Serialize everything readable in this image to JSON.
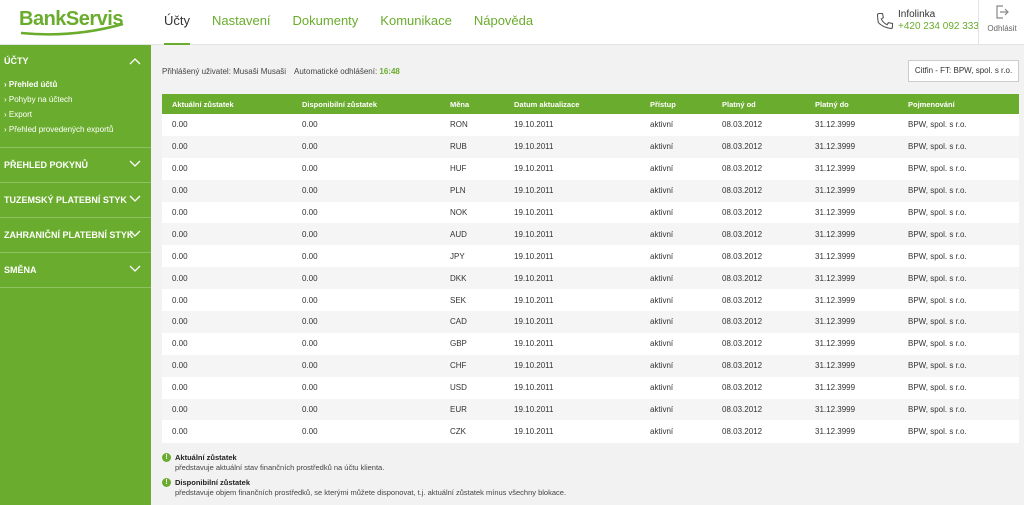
{
  "header": {
    "logo": "BankServis",
    "nav": [
      "Účty",
      "Nastavení",
      "Dokumenty",
      "Komunikace",
      "Nápověda"
    ],
    "info_title": "Infolinka",
    "info_phone": "+420 234 092 333",
    "logout_label": "Odhlásit",
    "brand_color": "#6aac2d"
  },
  "sidebar": {
    "sections": [
      {
        "label": "Účty",
        "items": [
          "Přehled účtů",
          "Pohyby na účtech",
          "Export",
          "Přehled provedených exportů"
        ]
      },
      {
        "label": "Přehled pokynů"
      },
      {
        "label": "Tuzemský platební styk"
      },
      {
        "label": "Zahraniční platební styk"
      },
      {
        "label": "Směna"
      }
    ]
  },
  "topbar": {
    "user": "Přihlášený uživatel: Musaši Musaši",
    "auto_logout_label": "Automatické odhlášení:",
    "auto_logout_time": "16:48",
    "account_select": "Citfin - FT: BPW, spol. s r.o."
  },
  "table": {
    "columns": [
      "Aktuální zůstatek",
      "Disponibilní zůstatek",
      "Měna",
      "Datum aktualizace",
      "Přístup",
      "Platný od",
      "Platný do",
      "Pojmenování"
    ],
    "rows": [
      [
        "0.00",
        "0.00",
        "RON",
        "19.10.2011",
        "aktivní",
        "08.03.2012",
        "31.12.3999",
        "BPW, spol. s r.o."
      ],
      [
        "0.00",
        "0.00",
        "RUB",
        "19.10.2011",
        "aktivní",
        "08.03.2012",
        "31.12.3999",
        "BPW, spol. s r.o."
      ],
      [
        "0.00",
        "0.00",
        "HUF",
        "19.10.2011",
        "aktivní",
        "08.03.2012",
        "31.12.3999",
        "BPW, spol. s r.o."
      ],
      [
        "0.00",
        "0.00",
        "PLN",
        "19.10.2011",
        "aktivní",
        "08.03.2012",
        "31.12.3999",
        "BPW, spol. s r.o."
      ],
      [
        "0.00",
        "0.00",
        "NOK",
        "19.10.2011",
        "aktivní",
        "08.03.2012",
        "31.12.3999",
        "BPW, spol. s r.o."
      ],
      [
        "0.00",
        "0.00",
        "AUD",
        "19.10.2011",
        "aktivní",
        "08.03.2012",
        "31.12.3999",
        "BPW, spol. s r.o."
      ],
      [
        "0.00",
        "0.00",
        "JPY",
        "19.10.2011",
        "aktivní",
        "08.03.2012",
        "31.12.3999",
        "BPW, spol. s r.o."
      ],
      [
        "0.00",
        "0.00",
        "DKK",
        "19.10.2011",
        "aktivní",
        "08.03.2012",
        "31.12.3999",
        "BPW, spol. s r.o."
      ],
      [
        "0.00",
        "0.00",
        "SEK",
        "19.10.2011",
        "aktivní",
        "08.03.2012",
        "31.12.3999",
        "BPW, spol. s r.o."
      ],
      [
        "0.00",
        "0.00",
        "CAD",
        "19.10.2011",
        "aktivní",
        "08.03.2012",
        "31.12.3999",
        "BPW, spol. s r.o."
      ],
      [
        "0.00",
        "0.00",
        "GBP",
        "19.10.2011",
        "aktivní",
        "08.03.2012",
        "31.12.3999",
        "BPW, spol. s r.o."
      ],
      [
        "0.00",
        "0.00",
        "CHF",
        "19.10.2011",
        "aktivní",
        "08.03.2012",
        "31.12.3999",
        "BPW, spol. s r.o."
      ],
      [
        "0.00",
        "0.00",
        "USD",
        "19.10.2011",
        "aktivní",
        "08.03.2012",
        "31.12.3999",
        "BPW, spol. s r.o."
      ],
      [
        "0.00",
        "0.00",
        "EUR",
        "19.10.2011",
        "aktivní",
        "08.03.2012",
        "31.12.3999",
        "BPW, spol. s r.o."
      ],
      [
        "0.00",
        "0.00",
        "CZK",
        "19.10.2011",
        "aktivní",
        "08.03.2012",
        "31.12.3999",
        "BPW, spol. s r.o."
      ]
    ]
  },
  "legend": [
    {
      "title": "Aktuální zůstatek",
      "desc": "představuje aktuální stav finančních prostředků na účtu klienta."
    },
    {
      "title": "Disponibilní zůstatek",
      "desc": "představuje objem finančních prostředků, se kterými můžete disponovat, t.j. aktuální zůstatek mínus všechny blokace."
    }
  ]
}
